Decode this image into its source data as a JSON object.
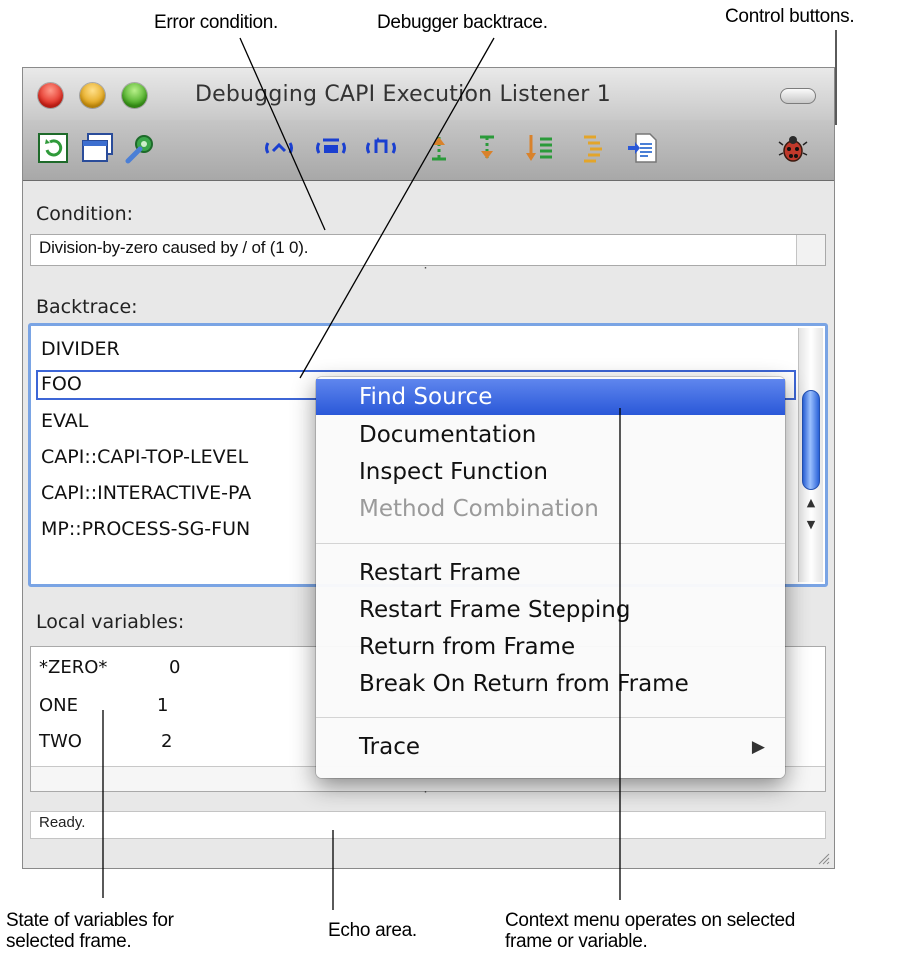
{
  "callouts": {
    "error_condition": "Error condition.",
    "debugger_backtrace": "Debugger backtrace.",
    "control_buttons": "Control buttons.",
    "state_of_variables_line1": "State of variables for",
    "state_of_variables_line2": "selected frame.",
    "echo_area": "Echo area.",
    "context_menu_line1": "Context menu operates on selected",
    "context_menu_line2": "frame or variable."
  },
  "window": {
    "title": "Debugging CAPI Execution Listener 1"
  },
  "toolbar": {
    "buttons": [
      {
        "name": "refresh-icon"
      },
      {
        "name": "window-icon"
      },
      {
        "name": "gear-icon"
      },
      {
        "name": "step-over-icon"
      },
      {
        "name": "step-through-icon"
      },
      {
        "name": "step-into-icon"
      },
      {
        "name": "frame-up-icon"
      },
      {
        "name": "frame-down-icon"
      },
      {
        "name": "frame-list-icon"
      },
      {
        "name": "frame-list-alt-icon"
      },
      {
        "name": "document-icon"
      },
      {
        "name": "bug-icon"
      }
    ]
  },
  "condition": {
    "label": "Condition:",
    "text": "Division-by-zero caused by / of (1 0)."
  },
  "backtrace": {
    "label": "Backtrace:",
    "frames": [
      "DIVIDER",
      "FOO",
      "EVAL",
      "CAPI::CAPI-TOP-LEVEL",
      "CAPI::INTERACTIVE-PA",
      "MP::PROCESS-SG-FUN"
    ],
    "selected_index": 1
  },
  "local_variables": {
    "label": "Local variables:",
    "rows": [
      {
        "name": "*ZERO*",
        "value": "0"
      },
      {
        "name": "ONE",
        "value": "1"
      },
      {
        "name": "TWO",
        "value": "2"
      }
    ]
  },
  "echo": {
    "text": "Ready."
  },
  "context_menu": {
    "items": [
      {
        "label": "Find Source",
        "state": "highlighted"
      },
      {
        "label": "Documentation",
        "state": "enabled"
      },
      {
        "label": "Inspect Function",
        "state": "enabled"
      },
      {
        "label": "Method Combination",
        "state": "disabled"
      },
      {
        "label": "Restart Frame",
        "state": "enabled"
      },
      {
        "label": "Restart Frame Stepping",
        "state": "enabled"
      },
      {
        "label": "Return from Frame",
        "state": "enabled"
      },
      {
        "label": "Break On Return from Frame",
        "state": "enabled"
      },
      {
        "label": "Trace",
        "state": "enabled",
        "submenu": true
      }
    ]
  },
  "colors": {
    "selection_blue": "#2a58d8",
    "selection_outline": "#3d66d6",
    "window_bg": "#e8e8e8"
  }
}
